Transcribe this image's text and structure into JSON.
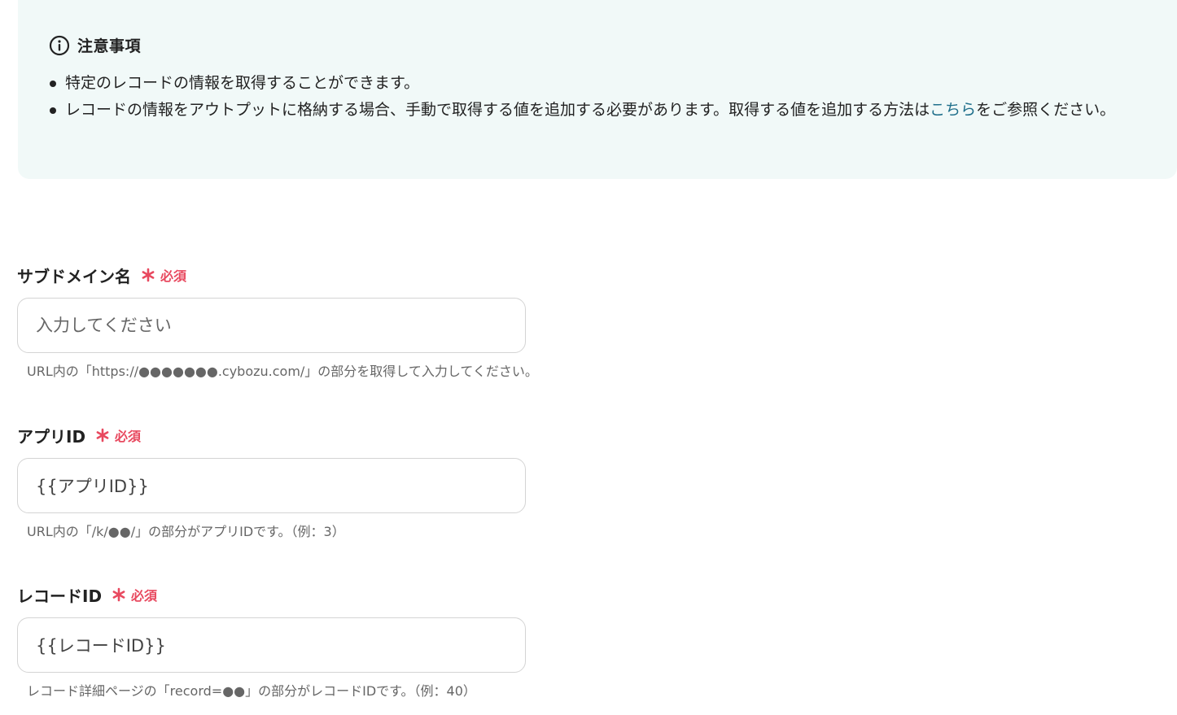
{
  "notice": {
    "icon": "info-circle-icon",
    "title": "注意事項",
    "items": [
      {
        "text": "特定のレコードの情報を取得することができます。"
      },
      {
        "text_before": "レコードの情報をアウトプットに格納する場合、手動で取得する値を追加する必要があります。取得する値を追加する方法は",
        "link_text": "こちら",
        "text_after": "をご参照ください。"
      }
    ]
  },
  "fields": [
    {
      "label": "サブドメイン名",
      "required_label": "必須",
      "value": "",
      "placeholder": "入力してください",
      "hint": "URL内の「https://●●●●●●●.cybozu.com/」の部分を取得して入力してください。"
    },
    {
      "label": "アプリID",
      "required_label": "必須",
      "value": "{{アプリID}}",
      "placeholder": "",
      "hint": "URL内の「/k/●●/」の部分がアプリIDです。（例：3）"
    },
    {
      "label": "レコードID",
      "required_label": "必須",
      "value": "{{レコードID}}",
      "placeholder": "",
      "hint": "レコード詳細ページの「record=●●」の部分がレコードIDです。（例：40）"
    }
  ],
  "colors": {
    "notice_background": "#f1f9f8",
    "required": "#e8495f",
    "link": "#1f6f8b"
  }
}
